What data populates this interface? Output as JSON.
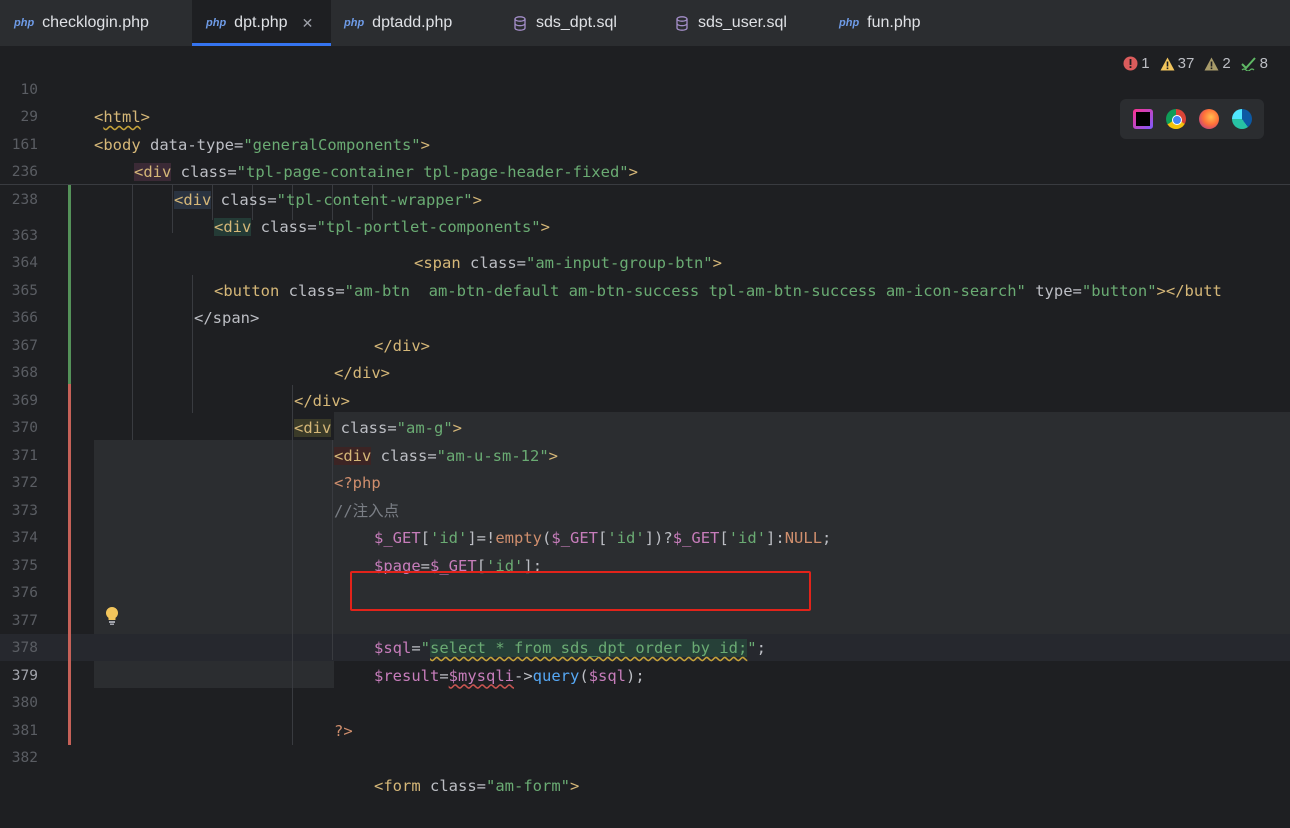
{
  "tabs": [
    {
      "label": "checklogin.php",
      "type": "php",
      "active": false
    },
    {
      "label": "dpt.php",
      "type": "php",
      "active": true
    },
    {
      "label": "dptadd.php",
      "type": "php",
      "active": false
    },
    {
      "label": "sds_dpt.sql",
      "type": "sql",
      "active": false
    },
    {
      "label": "sds_user.sql",
      "type": "sql",
      "active": false
    },
    {
      "label": "fun.php",
      "type": "php",
      "active": false
    }
  ],
  "file_type_label": "php",
  "inspections": {
    "errors": "1",
    "warnings": "37",
    "weak_warnings": "2",
    "typos": "8"
  },
  "browsers": [
    "phpstorm-icon",
    "chrome-icon",
    "firefox-icon",
    "edge-icon"
  ],
  "sticky_lines": [
    {
      "n": "10",
      "text": "<html>"
    },
    {
      "n": "29",
      "text": "<body data-type=\"generalComponents\">"
    },
    {
      "n": "161",
      "text": "<div class=\"tpl-page-container tpl-page-header-fixed\">"
    },
    {
      "n": "236",
      "text": "<div class=\"tpl-content-wrapper\">"
    },
    {
      "n": "238",
      "text": "<div class=\"tpl-portlet-components\">"
    }
  ],
  "lines": [
    {
      "n": "363",
      "text": "<span class=\"am-input-group-btn\">"
    },
    {
      "n": "364",
      "text": "<button class=\"am-btn  am-btn-default am-btn-success tpl-am-btn-success am-icon-search\" type=\"button\"></butt"
    },
    {
      "n": "365",
      "text": "</span>"
    },
    {
      "n": "366",
      "text": "</div>"
    },
    {
      "n": "367",
      "text": "</div>"
    },
    {
      "n": "368",
      "text": "</div>"
    },
    {
      "n": "369",
      "text": "<div class=\"am-g\">"
    },
    {
      "n": "370",
      "text": "<div class=\"am-u-sm-12\">"
    },
    {
      "n": "371",
      "text": "<?php"
    },
    {
      "n": "372",
      "text": "//注入点"
    },
    {
      "n": "373",
      "text": "$_GET['id']=!empty($_GET['id'])?$_GET['id']:NULL;"
    },
    {
      "n": "374",
      "text": "$page=$_GET['id'];"
    },
    {
      "n": "375",
      "text": ""
    },
    {
      "n": "376",
      "text": ""
    },
    {
      "n": "377",
      "text": "$sql=\"select * from sds_dpt order by id;\";"
    },
    {
      "n": "378",
      "text": "$result=$mysqli->query($sql);"
    },
    {
      "n": "379",
      "text": ""
    },
    {
      "n": "380",
      "text": "?>"
    },
    {
      "n": "381",
      "text": ""
    },
    {
      "n": "382",
      "text": "<form class=\"am-form\">"
    }
  ],
  "colors": {
    "background": "#1e1f22",
    "tag": "#d5b778",
    "string": "#6aab73",
    "variable": "#c77dbb",
    "keyword": "#cf8e6d",
    "function": "#56a8f5",
    "comment": "#7a7e85",
    "accent": "#3574f0",
    "highlight_box": "#e2231a"
  }
}
